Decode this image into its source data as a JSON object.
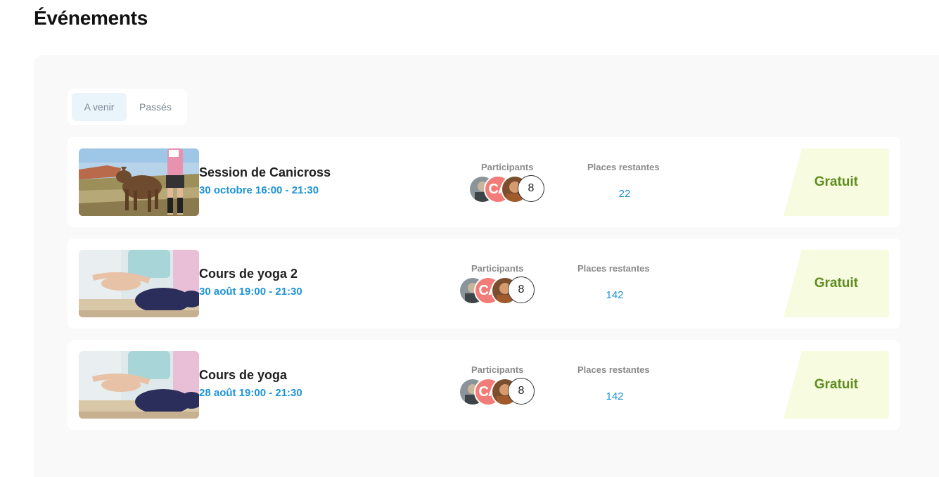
{
  "page": {
    "title": "Événements"
  },
  "tabs": [
    {
      "label": "A venir",
      "active": true
    },
    {
      "label": "Passés",
      "active": false
    }
  ],
  "labels": {
    "participants": "Participants",
    "places": "Places restantes"
  },
  "events": [
    {
      "title": "Session de Canicross",
      "date": "30 octobre 16:00 - 21:30",
      "image": "canicross-photo",
      "avatar_initials": "CA",
      "participants_extra": "8",
      "places_restantes": "22",
      "price": "Gratuit"
    },
    {
      "title": "Cours de yoga 2",
      "date": "30 août 19:00 - 21:30",
      "image": "yoga-photo",
      "avatar_initials": "CA",
      "participants_extra": "8",
      "places_restantes": "142",
      "price": "Gratuit"
    },
    {
      "title": "Cours de yoga",
      "date": "28 août 19:00 - 21:30",
      "image": "yoga-photo",
      "avatar_initials": "CA",
      "participants_extra": "8",
      "places_restantes": "142",
      "price": "Gratuit"
    }
  ],
  "colors": {
    "accent": "#1e93d6",
    "price_text": "#5e8c1e",
    "price_bg": "#f7fbe0",
    "tab_active_bg": "#eaf4fb",
    "initials_bg": "#f27c78"
  }
}
